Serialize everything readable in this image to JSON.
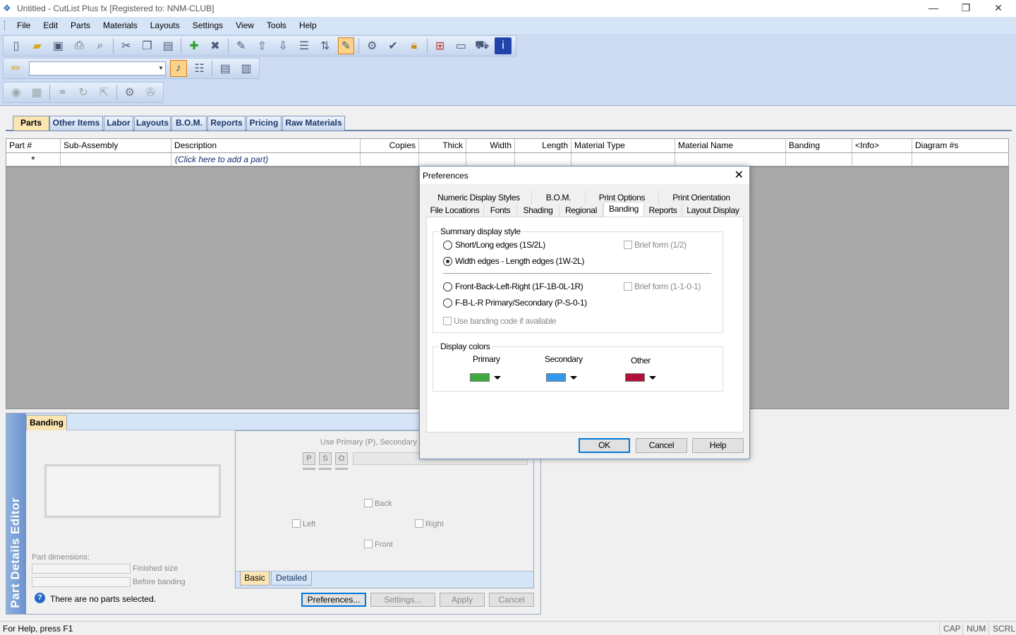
{
  "window": {
    "title": "Untitled - CutList Plus fx [Registered to: NNM-CLUB]",
    "minimize": "—",
    "restore": "❐",
    "close": "✕"
  },
  "menu": [
    "File",
    "Edit",
    "Parts",
    "Materials",
    "Layouts",
    "Settings",
    "View",
    "Tools",
    "Help"
  ],
  "main_tabs": [
    "Parts",
    "Other Items",
    "Labor",
    "Layouts",
    "B.O.M.",
    "Reports",
    "Pricing",
    "Raw Materials"
  ],
  "grid": {
    "columns": [
      "Part #",
      "Sub-Assembly",
      "Description",
      "Copies",
      "Thick",
      "Width",
      "Length",
      "Material Type",
      "Material Name",
      "Banding",
      "<Info>",
      "Diagram #s"
    ],
    "new_row_marker": "*",
    "add_part_hint": "(Click here to add a part)"
  },
  "part_editor": {
    "vertical_title": "Part Details Editor",
    "tab": "Banding",
    "use_hint": "Use Primary (P), Secondary (S)",
    "pso": [
      "P",
      "S",
      "O"
    ],
    "edges": {
      "back": "Back",
      "left": "Left",
      "right": "Right",
      "front": "Front"
    },
    "part_dimensions": "Part dimensions:",
    "finished_size": "Finished size",
    "before_banding": "Before banding",
    "view_tabs": [
      "Basic",
      "Detailed"
    ],
    "status": "There are no parts selected.",
    "buttons": {
      "preferences": "Preferences...",
      "settings": "Settings...",
      "apply": "Apply",
      "cancel": "Cancel"
    }
  },
  "dialog": {
    "title": "Preferences",
    "close": "✕",
    "tabs_row1": [
      "Numeric Display Styles",
      "B.O.M.",
      "Print Options",
      "Print Orientation"
    ],
    "tabs_row2": [
      "File Locations",
      "Fonts",
      "Shading",
      "Regional",
      "Banding",
      "Reports",
      "Layout Display"
    ],
    "selected_tab": "Banding",
    "summary": {
      "legend": "Summary display style",
      "opt1": "Short/Long edges (1S/2L)",
      "opt2": "Width edges - Length edges (1W-2L)",
      "opt3": "Front-Back-Left-Right (1F-1B-0L-1R)",
      "opt4": "F-B-L-R Primary/Secondary (P-S-0-1)",
      "brief1": "Brief form (1/2)",
      "brief2": "Brief form (1-1-0-1)",
      "use_code": "Use banding code if available"
    },
    "colors": {
      "legend": "Display colors",
      "primary_label": "Primary",
      "secondary_label": "Secondary",
      "other_label": "Other",
      "primary": "#3faa3f",
      "secondary": "#3399ee",
      "other": "#b0103a"
    },
    "buttons": {
      "ok": "OK",
      "cancel": "Cancel",
      "help": "Help"
    }
  },
  "status": {
    "help": "For Help, press F1",
    "cap": "CAP",
    "num": "NUM",
    "scrl": "SCRL"
  }
}
